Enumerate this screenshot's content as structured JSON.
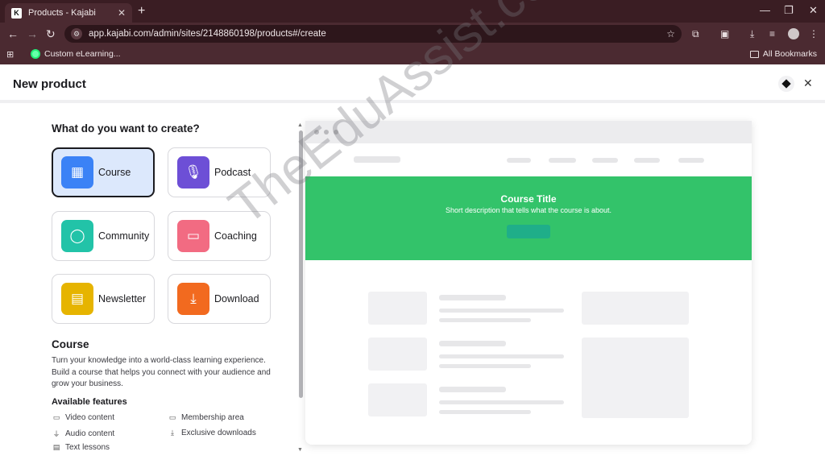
{
  "browser": {
    "tab_title": "Products - Kajabi",
    "tab_favicon": "K",
    "url": "app.kajabi.com/admin/sites/2148860198/products#/create",
    "bookmark": "Custom eLearning...",
    "all_bookmarks": "All Bookmarks"
  },
  "header": {
    "title": "New product"
  },
  "question": "What do you want to create?",
  "product_types": [
    {
      "label": "Course",
      "icon": "course-icon",
      "color": "#3b82f6"
    },
    {
      "label": "Podcast",
      "icon": "microphone-icon",
      "color": "#6d4fd6"
    },
    {
      "label": "Community",
      "icon": "chat-bubble-icon",
      "color": "#22c3a8"
    },
    {
      "label": "Coaching",
      "icon": "coaching-icon",
      "color": "#f26b82"
    },
    {
      "label": "Newsletter",
      "icon": "newsletter-icon",
      "color": "#e6b400"
    },
    {
      "label": "Download",
      "icon": "download-icon",
      "color": "#f26a1f"
    }
  ],
  "selected": {
    "title": "Course",
    "description": "Turn your knowledge into a world-class learning experience. Build a course that helps you connect with your audience and grow your business.",
    "features_title": "Available features",
    "features": [
      {
        "label": "Video content",
        "icon": "video-icon"
      },
      {
        "label": "Membership area",
        "icon": "video-icon"
      },
      {
        "label": "Audio content",
        "icon": "microphone-icon"
      },
      {
        "label": "Exclusive downloads",
        "icon": "download-icon"
      },
      {
        "label": "Text lessons",
        "icon": "document-icon"
      }
    ]
  },
  "preview": {
    "hero_title": "Course Title",
    "hero_subtitle": "Short description that tells what the course is about.",
    "hero_color": "#33c36a"
  },
  "watermark": "TheEduAssist.com"
}
